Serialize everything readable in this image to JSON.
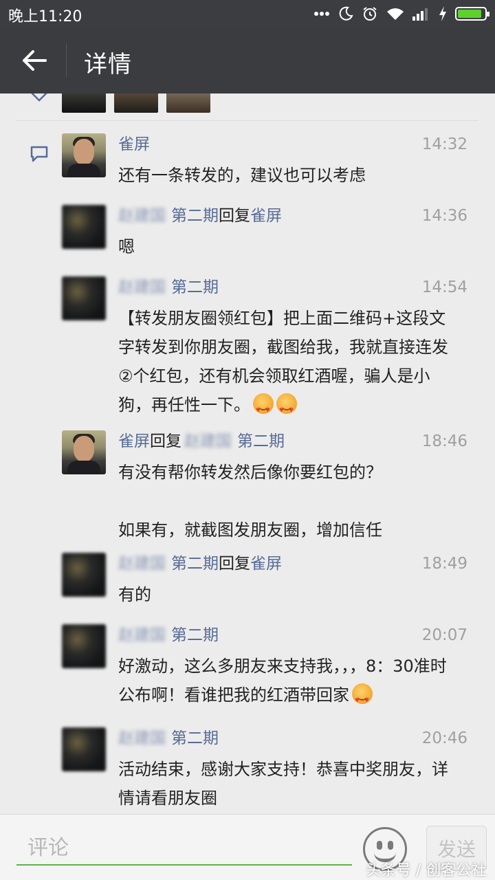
{
  "status_bar": {
    "time": "晚上11:20",
    "icons": [
      "more-dots-icon",
      "moon-icon",
      "alarm-icon",
      "wifi-icon",
      "signal-icon",
      "charging-icon",
      "battery-icon"
    ],
    "battery_level": 0.9,
    "battery_color": "#5cd12c"
  },
  "header": {
    "title": "详情",
    "back_icon": "arrow-left-icon"
  },
  "colors": {
    "header_bg": "#3a3c3f",
    "name_link": "#576b95",
    "time_gray": "#a0a0a0",
    "input_underline": "#5ab44a"
  },
  "comments": [
    {
      "name": "雀屏",
      "reply_word": "",
      "reply_to": "",
      "time": "14:32",
      "text": "还有一条转发的，建议也可以考虑"
    },
    {
      "name_blur": "赵建国",
      "name": "第二期",
      "reply_word": "回复",
      "reply_to": "雀屏",
      "time": "14:36",
      "text": "嗯"
    },
    {
      "name_blur": "赵建国",
      "name": "第二期",
      "time": "14:54",
      "text": "【转发朋友圈领红包】把上面二维码+这段文字转发到你朋友圈，截图给我，我就直接连发②个红包，还有机会领取红酒喔，骗人是小狗，再任性一下。"
    },
    {
      "name": "雀屏",
      "reply_word": "回复",
      "reply_to_blur": "赵建国",
      "reply_to": "第二期",
      "time": "18:46",
      "text": "有没有帮你转发然后像你要红包的？\n\n如果有，就截图发朋友圈，增加信任"
    },
    {
      "name_blur": "赵建国",
      "name": "第二期",
      "reply_word": "回复",
      "reply_to": "雀屏",
      "time": "18:49",
      "text": "有的"
    },
    {
      "name_blur": "赵建国",
      "name": "第二期",
      "time": "20:07",
      "text": "好激动，这么多朋友来支持我，，，8：30准时公布啊！看谁把我的红酒带回家"
    },
    {
      "name_blur": "赵建国",
      "name": "第二期",
      "time": "20:46",
      "text": "活动结束，感谢大家支持！恭喜中奖朋友，详情请看朋友圈"
    }
  ],
  "bottom_bar": {
    "input_placeholder": "评论",
    "send_label": "发送",
    "emoji_icon": "smiley-icon"
  },
  "watermark": "头条号 / 创客公社"
}
